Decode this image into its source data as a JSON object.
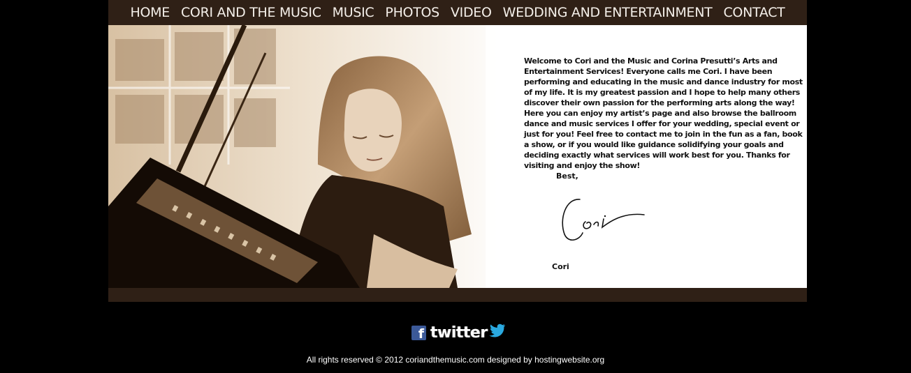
{
  "nav": {
    "items": [
      {
        "label": "HOME"
      },
      {
        "label": "CORI AND THE MUSIC"
      },
      {
        "label": "MUSIC"
      },
      {
        "label": "PHOTOS"
      },
      {
        "label": "VIDEO"
      },
      {
        "label": "WEDDING AND ENTERTAINMENT"
      },
      {
        "label": "CONTACT"
      }
    ]
  },
  "photo": {
    "icon": "pianist-photo"
  },
  "welcome": {
    "text": "Welcome to Cori and the Music and Corina Presutti’s Arts and Entertainment Services!  Everyone calls me Cori.  I have been performing and educating in the music and dance industry for most of my life.  It is my greatest passion and I hope to help many others discover their own passion for the performing arts along the way!  Here you can enjoy my artist’s page and also browse the ballroom dance and music services I offer for your wedding, special event or just for you!  Feel free to contact me to join in the fun as a fan, book a show, or if you would like guidance solidifying your goals and deciding exactly what services will work best for you.  Thanks for visiting and enjoy the show!",
    "closing": "Best,",
    "signature_text": "Cori",
    "signer": "Cori"
  },
  "social": {
    "facebook_icon": "facebook-icon",
    "facebook_glyph": "f",
    "twitter_label": "twitter",
    "twitter_icon": "twitter-bird-icon"
  },
  "footer": {
    "copyright": "All rights reserved © 2012 coriandthemusic.com designed by hostingwebsite.org"
  },
  "colors": {
    "nav_bg": "#2f2016",
    "nav_text": "#f4efe9",
    "page_bg": "#000000",
    "sepia": "#b08a63",
    "twitter_blue": "#2aa9e0",
    "facebook_blue": "#3b5998"
  }
}
